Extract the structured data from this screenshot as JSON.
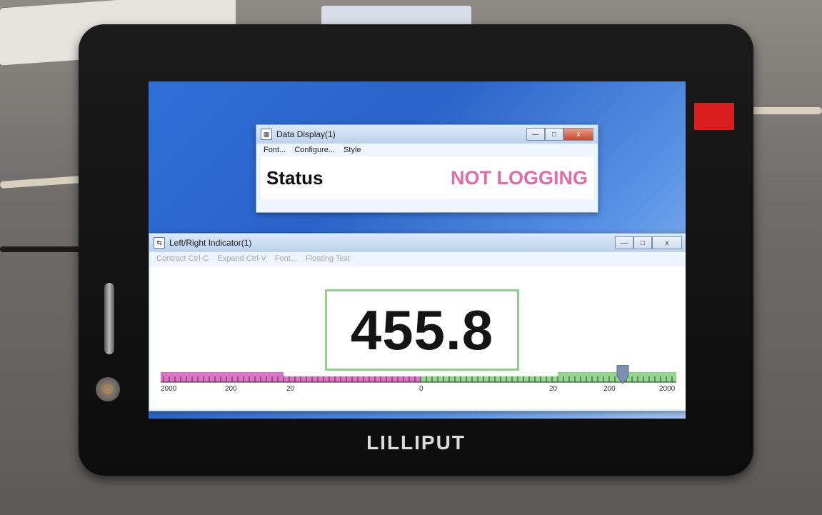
{
  "monitor": {
    "brand": "LILLIPUT"
  },
  "data_display": {
    "title": "Data Display(1)",
    "menu": [
      "Font...",
      "Configure...",
      "Style"
    ],
    "label": "Status",
    "value": "NOT LOGGING",
    "value_color": "#e46aa8"
  },
  "lr_indicator": {
    "title": "Left/Right Indicator(1)",
    "menu": [
      "Contract Ctrl-C",
      "Expand Ctrl-V",
      "Font...",
      "Floating Text"
    ],
    "reading": "455.8",
    "scale_labels": [
      "2000",
      "200",
      "20",
      "0",
      "20",
      "200",
      "2000"
    ],
    "left_color": "#e070c8",
    "right_color": "#8fd88a",
    "frame_color": "#8fd08c"
  },
  "window_controls": {
    "minimize": "—",
    "maximize": "□",
    "close": "x"
  }
}
